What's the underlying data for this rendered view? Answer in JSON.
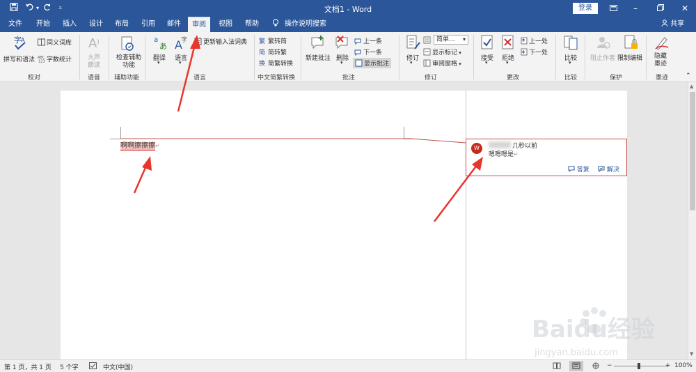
{
  "titlebar": {
    "title": "文档1  -  Word",
    "login_label": "登录",
    "quick_access": [
      "save-icon",
      "undo-icon",
      "redo-icon",
      "customize-icon"
    ]
  },
  "tabs": [
    {
      "label": "文件"
    },
    {
      "label": "开始"
    },
    {
      "label": "插入"
    },
    {
      "label": "设计"
    },
    {
      "label": "布局"
    },
    {
      "label": "引用"
    },
    {
      "label": "邮件"
    },
    {
      "label": "审阅"
    },
    {
      "label": "视图"
    },
    {
      "label": "帮助"
    },
    {
      "label": "操作说明搜索"
    }
  ],
  "active_tab": "审阅",
  "share_label": "共享",
  "ribbon": {
    "proofing": {
      "spelling": "拼写和语法",
      "thesaurus": "同义词库",
      "word_count": "字数统计",
      "group": "校对"
    },
    "speech": {
      "read_aloud": "大声朗读",
      "group": "语音"
    },
    "accessibility": {
      "check": "检查辅助功能",
      "group": "辅助功能"
    },
    "language": {
      "translate": "翻译",
      "language": "语言",
      "update_ime": "更新输入法词典",
      "group": "语言"
    },
    "chinese_conv": {
      "to_simplified": "繁转简",
      "to_traditional": "简转繁",
      "conversion": "简繁转换",
      "group": "中文简繁转换"
    },
    "comments": {
      "new": "新建批注",
      "delete": "删除",
      "prev": "上一条",
      "next": "下一条",
      "show": "显示批注",
      "group": "批注"
    },
    "tracking": {
      "track": "修订",
      "simple_markup": "简单...",
      "show_markup": "显示标记",
      "review_pane": "审阅窗格",
      "group": "修订"
    },
    "changes": {
      "accept": "接受",
      "reject": "拒绝",
      "prev": "上一处",
      "next": "下一处",
      "group": "更改"
    },
    "compare": {
      "compare": "比较",
      "group": "比较"
    },
    "protect": {
      "block_authors": "阻止作者",
      "restrict": "限制编辑",
      "group": "保护"
    },
    "ink": {
      "hide_ink": "隐藏墨迹",
      "group": "墨迹"
    }
  },
  "document": {
    "text": "啊啊擦擦擦",
    "comment": {
      "avatar_letter": "W",
      "time": "几秒以前",
      "text": "嗯嗯嗯是",
      "reply": "答复",
      "resolve": "解决"
    }
  },
  "status": {
    "page": "第 1 页，共 1 页",
    "words": "5 个字",
    "language": "中文(中国)",
    "zoom": "100%"
  },
  "watermark": {
    "brand": "Baidu经验",
    "url": "jingyan.baidu.com"
  },
  "colors": {
    "brand_blue": "#2b579a",
    "comment_red": "#c0504d",
    "arrow_red": "#e8352b"
  }
}
